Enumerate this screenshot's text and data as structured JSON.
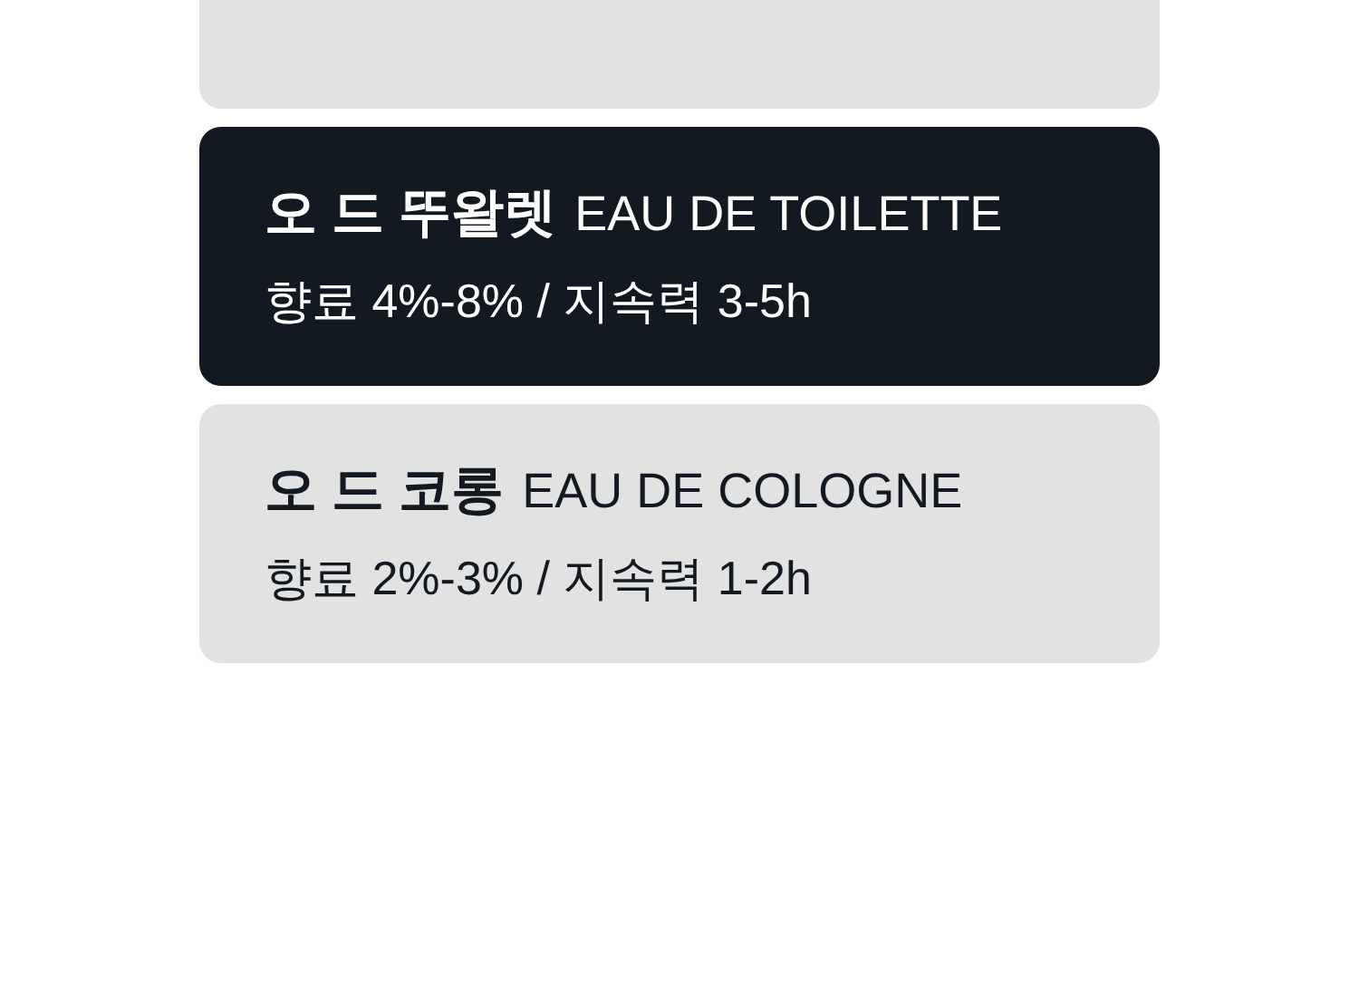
{
  "options": [
    {
      "selected": false
    },
    {
      "name": "오 드 뚜왈렛",
      "name_en": "EAU DE TOILETTE",
      "detail": "향료 4%-8% / 지속력 3-5h",
      "selected": true
    },
    {
      "name": "오 드 코롱",
      "name_en": "EAU DE COLOGNE",
      "detail": "향료 2%-3% / 지속력 1-2h",
      "selected": false
    }
  ]
}
